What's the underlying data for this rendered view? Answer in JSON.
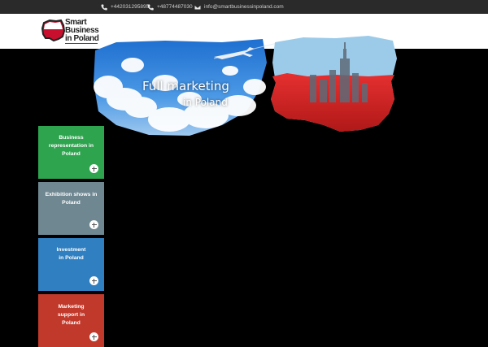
{
  "topbar": {
    "phone1": "+442031295895",
    "phone2": "+48774487030",
    "email": "info@smartbusinessinpoland.com"
  },
  "logo": {
    "line1": "Smart",
    "line2": "Business",
    "line3": "in Poland"
  },
  "banner": {
    "headline": "Full marketing",
    "subline": "in Poland"
  },
  "tiles": [
    {
      "label": "Business representation in Poland",
      "color": "#2ea44f"
    },
    {
      "label": "Exhibition shows in Poland",
      "color": "#6f8791"
    },
    {
      "label": "Investment in Poland",
      "color": "#2f7fc1"
    },
    {
      "label": "Marketing support in Poland",
      "color": "#c0392b"
    }
  ],
  "colors": {
    "topbar": "#2a2a2a",
    "header": "#ffffff",
    "body": "#000000",
    "accent_red": "#c8102e"
  },
  "icons": [
    "phone-icon",
    "phone-icon",
    "envelope-icon",
    "plus-circle-icon"
  ]
}
